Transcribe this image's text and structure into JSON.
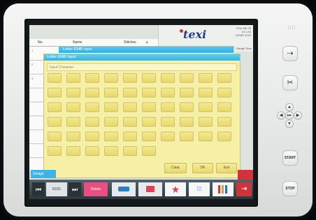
{
  "brand": {
    "logo": "texi",
    "info": [
      "TEXI MK 23",
      "10.1.53",
      "HOME 2019"
    ]
  },
  "table": {
    "headers": {
      "no": "No.",
      "name": "Name",
      "stitches": "Stitches",
      "extra": "∠"
    },
    "row_numbers": [
      "1",
      "2",
      "3"
    ],
    "range_tab": "Range Time"
  },
  "dialog_back": {
    "title": "Letter EMB Input"
  },
  "dialog": {
    "title": "Letter EMB Input",
    "input_label": "Input Character",
    "buttons": {
      "clear": "Clear",
      "ok": "OK",
      "exit": "Exit"
    }
  },
  "side_tag": "Design",
  "toolbar": {
    "page": "01/01",
    "delete": "Delete"
  },
  "hardware": {
    "next": "⇢",
    "cut": "✂",
    "up": "▲",
    "down": "▼",
    "left": "◀",
    "right": "▶",
    "center": "▸▸",
    "start": "START",
    "stop": "STOP",
    "dots": "∷∷"
  },
  "colors": {
    "accent": "#3fb3e4",
    "dialog": "#f6efa6",
    "brand": "#263f88"
  }
}
